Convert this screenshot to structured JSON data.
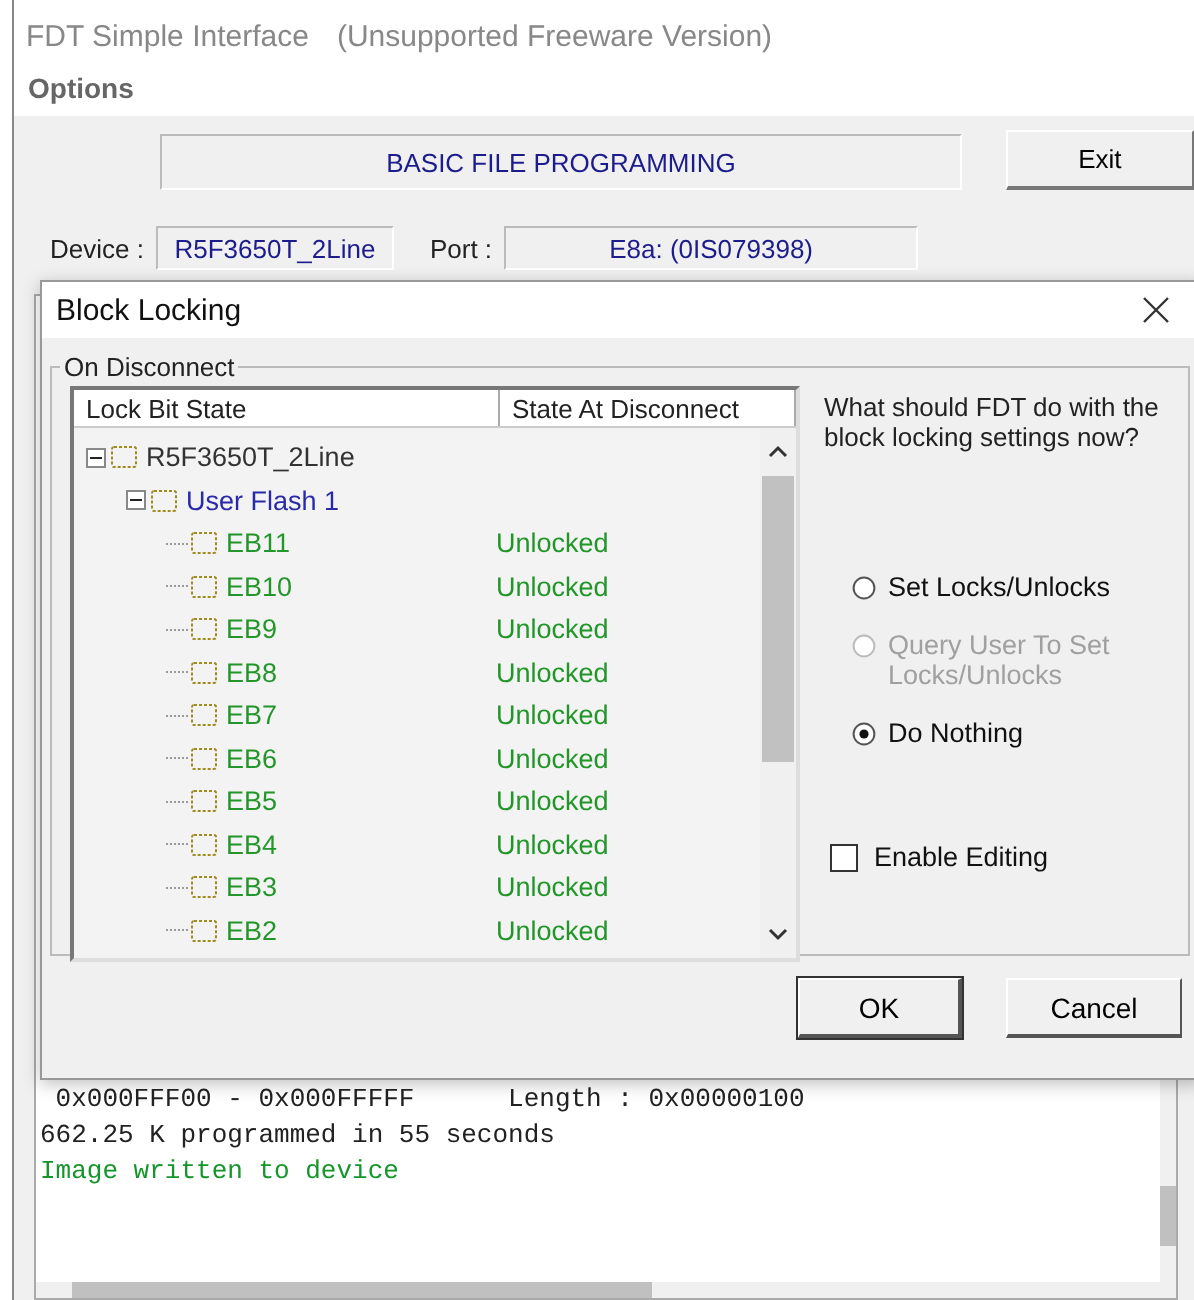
{
  "window": {
    "title": "FDT Simple Interface",
    "subtitle": "(Unsupported Freeware Version)"
  },
  "menu": [
    {
      "label": "Options"
    }
  ],
  "banner": "BASIC FILE PROGRAMMING",
  "exit_button": "Exit",
  "device": {
    "label": "Device :",
    "value": "R5F3650T_2Line"
  },
  "port": {
    "label": "Port :",
    "value": "E8a: (0IS079398)"
  },
  "log": [
    {
      "text": " 0x000FFF00 - 0x000FFFFF      Length : 0x00000100",
      "kind": "info"
    },
    {
      "text": "662.25 K programmed in 55 seconds",
      "kind": "info"
    },
    {
      "text": "Image written to device",
      "kind": "success"
    }
  ],
  "dialog": {
    "title": "Block Locking",
    "group": "On Disconnect",
    "columns": [
      "Lock Bit State",
      "State At Disconnect"
    ],
    "tree": [
      {
        "label": "R5F3650T_2Line",
        "kind": "device",
        "expanded": true,
        "children": [
          {
            "label": "User Flash 1",
            "kind": "area",
            "expanded": true,
            "children": [
              {
                "label": "EB11",
                "kind": "block",
                "state": "Unlocked"
              },
              {
                "label": "EB10",
                "kind": "block",
                "state": "Unlocked"
              },
              {
                "label": "EB9",
                "kind": "block",
                "state": "Unlocked"
              },
              {
                "label": "EB8",
                "kind": "block",
                "state": "Unlocked"
              },
              {
                "label": "EB7",
                "kind": "block",
                "state": "Unlocked"
              },
              {
                "label": "EB6",
                "kind": "block",
                "state": "Unlocked"
              },
              {
                "label": "EB5",
                "kind": "block",
                "state": "Unlocked"
              },
              {
                "label": "EB4",
                "kind": "block",
                "state": "Unlocked"
              },
              {
                "label": "EB3",
                "kind": "block",
                "state": "Unlocked"
              },
              {
                "label": "EB2",
                "kind": "block",
                "state": "Unlocked"
              }
            ]
          }
        ]
      }
    ],
    "question": "What should FDT do with the block locking settings now?",
    "options": [
      {
        "label": "Set Locks/Unlocks",
        "selected": false,
        "disabled": false
      },
      {
        "label": "Query User To Set Locks/Unlocks",
        "selected": false,
        "disabled": true
      },
      {
        "label": "Do Nothing",
        "selected": true,
        "disabled": false
      }
    ],
    "enable_editing": {
      "label": "Enable Editing",
      "checked": false
    },
    "buttons": [
      "OK",
      "Cancel"
    ]
  }
}
